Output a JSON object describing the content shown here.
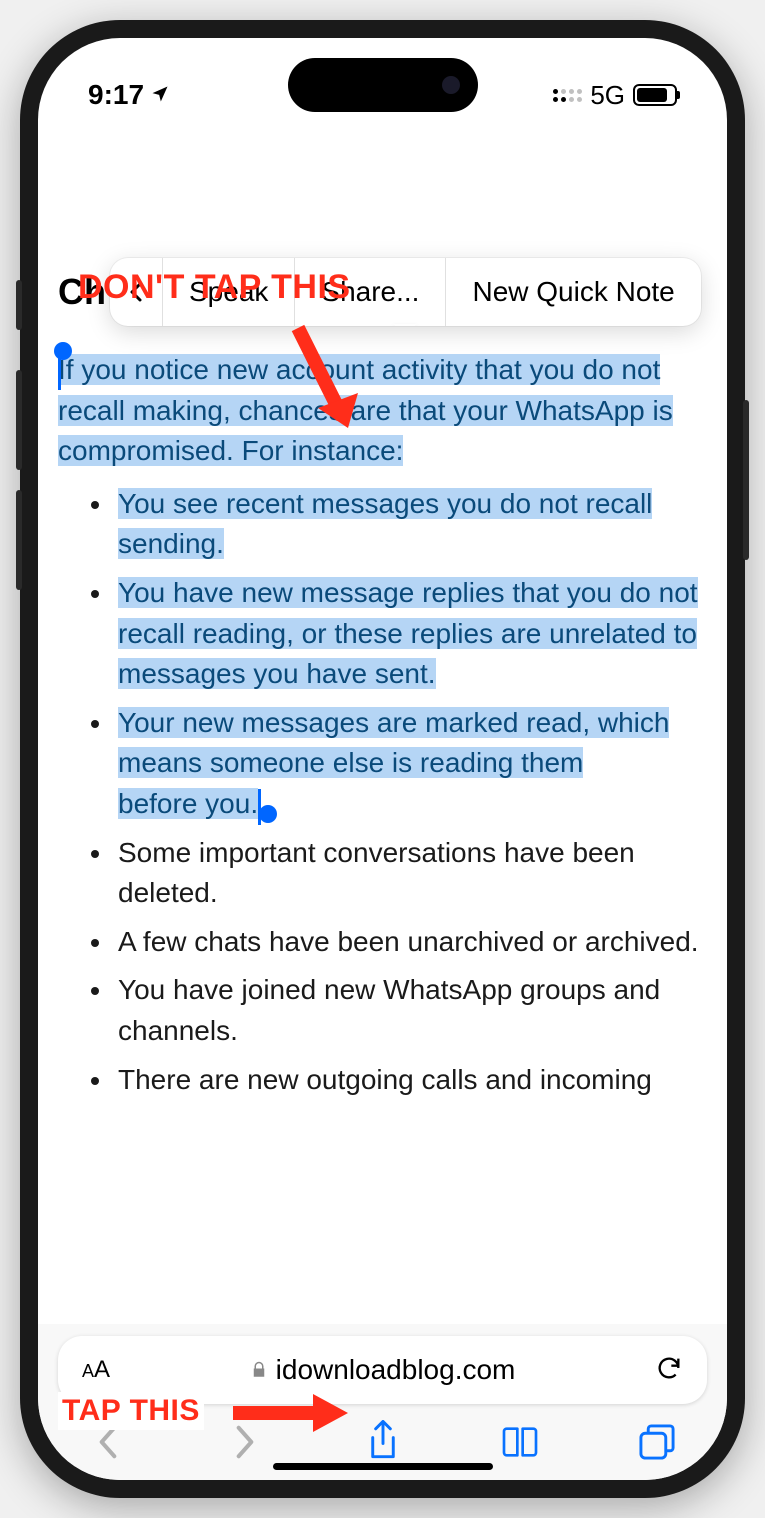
{
  "status_bar": {
    "time": "9:17",
    "network": "5G"
  },
  "annotations": {
    "top_label": "DON'T TAP THIS",
    "bottom_label": "TAP THIS"
  },
  "heading_partial": "Ch",
  "context_menu": {
    "item_speak": "Speak",
    "item_share": "Share...",
    "item_note": "New Quick Note"
  },
  "article": {
    "intro": "If you notice new account activity that you do not recall making, chances are that your WhatsApp is compromised. For instance:",
    "bullets": [
      "You see recent messages you do not recall sending.",
      "You have new message replies that you do not recall reading, or these replies are unrelated to messages you have sent.",
      "Your new messages are marked read, which means someone else is reading them ",
      "before you.",
      "Some important conversations have been deleted.",
      "A few chats have been unarchived or archived.",
      "You have joined new WhatsApp groups and channels.",
      "There are new outgoing calls and incoming"
    ]
  },
  "url_bar": {
    "aa": "AA",
    "domain": "idownloadblog.com"
  }
}
